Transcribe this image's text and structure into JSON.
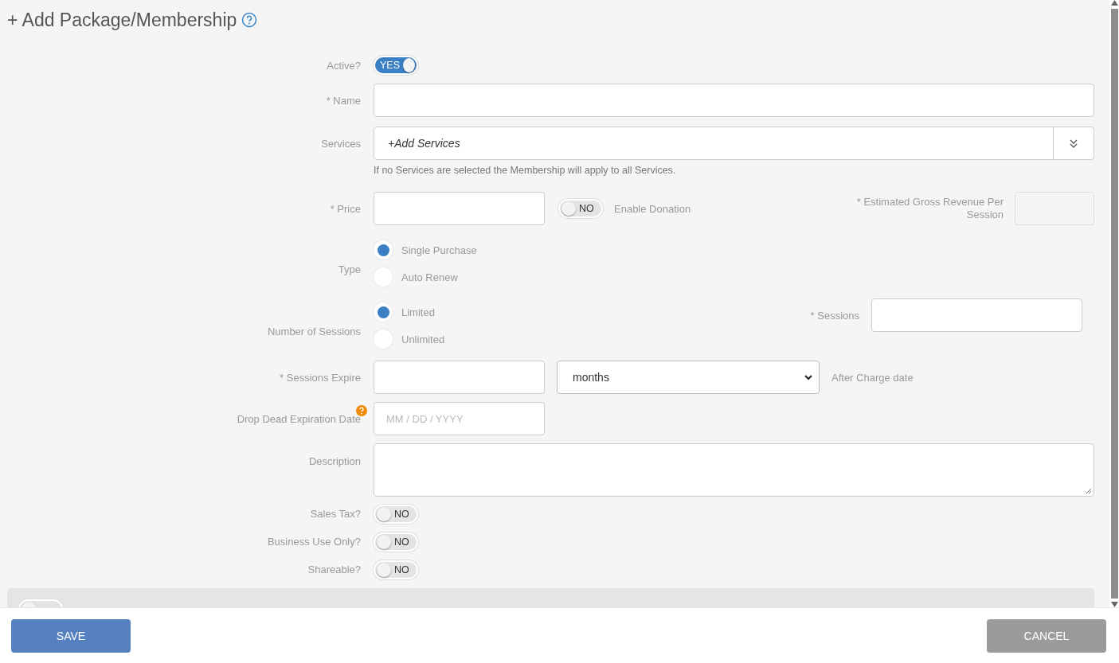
{
  "title": "+ Add Package/Membership",
  "fields": [
    {
      "kind": "toggle",
      "label": "Active?",
      "toggle": {
        "on": true,
        "text": "YES"
      }
    },
    {
      "kind": "text",
      "label": "* Name"
    },
    {
      "kind": "multiselect",
      "label": "Services",
      "value": "+Add Services",
      "hint": "If no Services are selected the Membership will apply to all Services."
    },
    {
      "kind": "price",
      "label": "* Price",
      "toggle": {
        "on": false,
        "text": "NO"
      },
      "toggle_label": "Enable Donation",
      "side_label": "* Estimated Gross Revenue Per Session"
    },
    {
      "kind": "radio",
      "label": "Type",
      "options": [
        {
          "label": "Single Purchase",
          "selected": true
        },
        {
          "label": "Auto Renew",
          "selected": false
        }
      ]
    },
    {
      "kind": "radio",
      "label": "Number of Sessions",
      "options": [
        {
          "label": "Limited",
          "selected": true
        },
        {
          "label": "Unlimited",
          "selected": false
        }
      ],
      "side_label": "* Sessions"
    },
    {
      "kind": "expire",
      "label": "* Sessions Expire",
      "unit": "months",
      "suffix": "After Charge date"
    },
    {
      "kind": "date",
      "label": "Drop Dead Expiration Date",
      "placeholder": "MM / DD / YYYY"
    },
    {
      "kind": "textarea",
      "label": "Description"
    },
    {
      "kind": "toggle",
      "label": "Sales Tax?",
      "toggle": {
        "on": false,
        "text": "NO"
      }
    },
    {
      "kind": "toggle",
      "label": "Business Use Only?",
      "toggle": {
        "on": false,
        "text": "NO"
      }
    },
    {
      "kind": "toggle",
      "label": "Shareable?",
      "toggle": {
        "on": false,
        "text": "NO"
      }
    }
  ],
  "limit_panel": {
    "toggle": {
      "on": false
    }
  },
  "buttons": [
    {
      "label": "SAVE",
      "kind": "primary"
    },
    {
      "label": "CANCEL",
      "kind": "secondary"
    }
  ]
}
